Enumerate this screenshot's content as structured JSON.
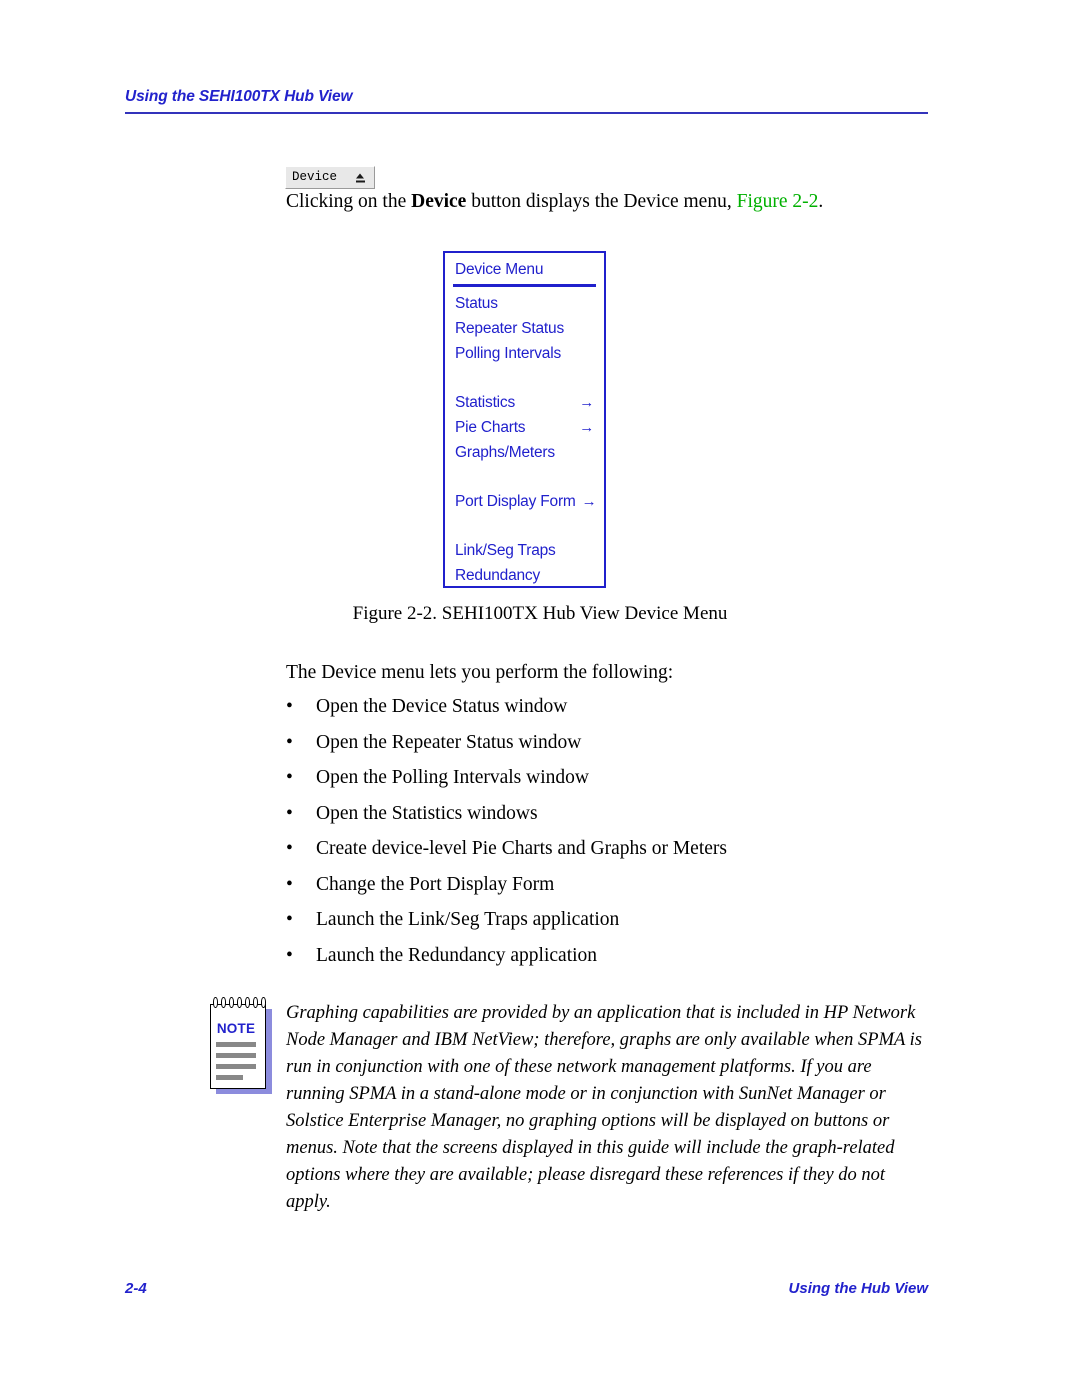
{
  "header": {
    "running_title": "Using the SEHI100TX Hub View"
  },
  "device_button": {
    "label": "Device",
    "indicator_icon": "up-down-option-menu-arrow"
  },
  "intro": {
    "part1": "Clicking on the ",
    "bold_term": "Device",
    "part2": " button displays the Device menu, ",
    "xref": "Figure 2-2",
    "part3": "."
  },
  "device_menu": {
    "title": "Device Menu",
    "arrow_glyph": "→",
    "groups": [
      {
        "items": [
          {
            "label": "Status",
            "submenu": false
          },
          {
            "label": "Repeater Status",
            "submenu": false
          },
          {
            "label": "Polling Intervals",
            "submenu": false
          }
        ]
      },
      {
        "items": [
          {
            "label": "Statistics",
            "submenu": true
          },
          {
            "label": "Pie Charts",
            "submenu": true
          },
          {
            "label": "Graphs/Meters",
            "submenu": false
          }
        ]
      },
      {
        "items": [
          {
            "label": "Port Display Form",
            "submenu": true,
            "tight_arrow": true
          }
        ]
      },
      {
        "items": [
          {
            "label": "Link/Seg Traps",
            "submenu": false
          },
          {
            "label": "Redundancy",
            "submenu": false
          }
        ]
      }
    ]
  },
  "figure": {
    "caption": "Figure 2-2.  SEHI100TX Hub View Device Menu"
  },
  "list": {
    "lead_in": "The Device menu lets you perform the following:",
    "bullet_glyph": "•",
    "items": [
      "Open the Device Status window",
      "Open the Repeater Status window",
      "Open the Polling Intervals window",
      "Open the Statistics windows",
      "Create device-level Pie Charts and Graphs or Meters",
      "Change the Port Display Form",
      "Launch the Link/Seg Traps application",
      "Launch the Redundancy application"
    ]
  },
  "note": {
    "icon_label": "NOTE",
    "text": "Graphing capabilities are provided by an application that is included in HP Network Node Manager and IBM NetView; therefore, graphs are only available when SPMA is run in conjunction with one of these network management platforms. If you are running SPMA in a stand-alone mode or in conjunction with SunNet Manager or Solstice Enterprise Manager, no graphing options will be displayed on buttons or menus. Note that the screens displayed in this guide will include the graph-related options where they are available; please disregard these references if they do not apply."
  },
  "footer": {
    "page_number": "2-4",
    "section_title": "Using the Hub View"
  },
  "colors": {
    "header_blue": "#2222cc",
    "menu_blue": "#2020cc",
    "xref_green": "#00b000",
    "note_gray": "#888888",
    "note_shadow": "#8c8cdd"
  }
}
